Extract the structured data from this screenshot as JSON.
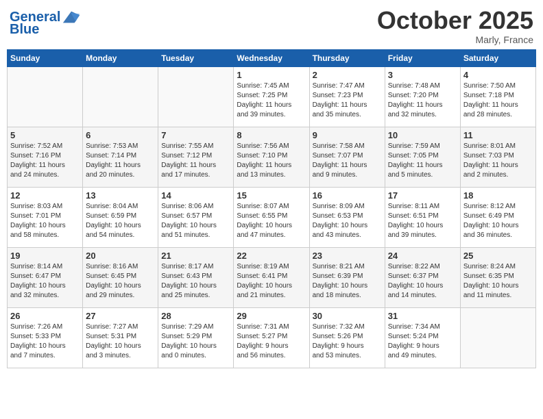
{
  "header": {
    "logo_line1": "General",
    "logo_line2": "Blue",
    "month": "October 2025",
    "location": "Marly, France"
  },
  "days_of_week": [
    "Sunday",
    "Monday",
    "Tuesday",
    "Wednesday",
    "Thursday",
    "Friday",
    "Saturday"
  ],
  "weeks": [
    [
      {
        "day": "",
        "info": ""
      },
      {
        "day": "",
        "info": ""
      },
      {
        "day": "",
        "info": ""
      },
      {
        "day": "1",
        "info": "Sunrise: 7:45 AM\nSunset: 7:25 PM\nDaylight: 11 hours\nand 39 minutes."
      },
      {
        "day": "2",
        "info": "Sunrise: 7:47 AM\nSunset: 7:23 PM\nDaylight: 11 hours\nand 35 minutes."
      },
      {
        "day": "3",
        "info": "Sunrise: 7:48 AM\nSunset: 7:20 PM\nDaylight: 11 hours\nand 32 minutes."
      },
      {
        "day": "4",
        "info": "Sunrise: 7:50 AM\nSunset: 7:18 PM\nDaylight: 11 hours\nand 28 minutes."
      }
    ],
    [
      {
        "day": "5",
        "info": "Sunrise: 7:52 AM\nSunset: 7:16 PM\nDaylight: 11 hours\nand 24 minutes."
      },
      {
        "day": "6",
        "info": "Sunrise: 7:53 AM\nSunset: 7:14 PM\nDaylight: 11 hours\nand 20 minutes."
      },
      {
        "day": "7",
        "info": "Sunrise: 7:55 AM\nSunset: 7:12 PM\nDaylight: 11 hours\nand 17 minutes."
      },
      {
        "day": "8",
        "info": "Sunrise: 7:56 AM\nSunset: 7:10 PM\nDaylight: 11 hours\nand 13 minutes."
      },
      {
        "day": "9",
        "info": "Sunrise: 7:58 AM\nSunset: 7:07 PM\nDaylight: 11 hours\nand 9 minutes."
      },
      {
        "day": "10",
        "info": "Sunrise: 7:59 AM\nSunset: 7:05 PM\nDaylight: 11 hours\nand 5 minutes."
      },
      {
        "day": "11",
        "info": "Sunrise: 8:01 AM\nSunset: 7:03 PM\nDaylight: 11 hours\nand 2 minutes."
      }
    ],
    [
      {
        "day": "12",
        "info": "Sunrise: 8:03 AM\nSunset: 7:01 PM\nDaylight: 10 hours\nand 58 minutes."
      },
      {
        "day": "13",
        "info": "Sunrise: 8:04 AM\nSunset: 6:59 PM\nDaylight: 10 hours\nand 54 minutes."
      },
      {
        "day": "14",
        "info": "Sunrise: 8:06 AM\nSunset: 6:57 PM\nDaylight: 10 hours\nand 51 minutes."
      },
      {
        "day": "15",
        "info": "Sunrise: 8:07 AM\nSunset: 6:55 PM\nDaylight: 10 hours\nand 47 minutes."
      },
      {
        "day": "16",
        "info": "Sunrise: 8:09 AM\nSunset: 6:53 PM\nDaylight: 10 hours\nand 43 minutes."
      },
      {
        "day": "17",
        "info": "Sunrise: 8:11 AM\nSunset: 6:51 PM\nDaylight: 10 hours\nand 39 minutes."
      },
      {
        "day": "18",
        "info": "Sunrise: 8:12 AM\nSunset: 6:49 PM\nDaylight: 10 hours\nand 36 minutes."
      }
    ],
    [
      {
        "day": "19",
        "info": "Sunrise: 8:14 AM\nSunset: 6:47 PM\nDaylight: 10 hours\nand 32 minutes."
      },
      {
        "day": "20",
        "info": "Sunrise: 8:16 AM\nSunset: 6:45 PM\nDaylight: 10 hours\nand 29 minutes."
      },
      {
        "day": "21",
        "info": "Sunrise: 8:17 AM\nSunset: 6:43 PM\nDaylight: 10 hours\nand 25 minutes."
      },
      {
        "day": "22",
        "info": "Sunrise: 8:19 AM\nSunset: 6:41 PM\nDaylight: 10 hours\nand 21 minutes."
      },
      {
        "day": "23",
        "info": "Sunrise: 8:21 AM\nSunset: 6:39 PM\nDaylight: 10 hours\nand 18 minutes."
      },
      {
        "day": "24",
        "info": "Sunrise: 8:22 AM\nSunset: 6:37 PM\nDaylight: 10 hours\nand 14 minutes."
      },
      {
        "day": "25",
        "info": "Sunrise: 8:24 AM\nSunset: 6:35 PM\nDaylight: 10 hours\nand 11 minutes."
      }
    ],
    [
      {
        "day": "26",
        "info": "Sunrise: 7:26 AM\nSunset: 5:33 PM\nDaylight: 10 hours\nand 7 minutes."
      },
      {
        "day": "27",
        "info": "Sunrise: 7:27 AM\nSunset: 5:31 PM\nDaylight: 10 hours\nand 3 minutes."
      },
      {
        "day": "28",
        "info": "Sunrise: 7:29 AM\nSunset: 5:29 PM\nDaylight: 10 hours\nand 0 minutes."
      },
      {
        "day": "29",
        "info": "Sunrise: 7:31 AM\nSunset: 5:27 PM\nDaylight: 9 hours\nand 56 minutes."
      },
      {
        "day": "30",
        "info": "Sunrise: 7:32 AM\nSunset: 5:26 PM\nDaylight: 9 hours\nand 53 minutes."
      },
      {
        "day": "31",
        "info": "Sunrise: 7:34 AM\nSunset: 5:24 PM\nDaylight: 9 hours\nand 49 minutes."
      },
      {
        "day": "",
        "info": ""
      }
    ]
  ]
}
